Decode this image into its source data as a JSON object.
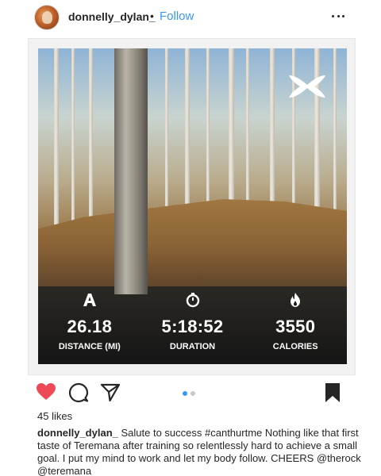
{
  "header": {
    "username": "donnelly_dylan_",
    "separator": "•",
    "follow_label": "Follow"
  },
  "media": {
    "brand_logo": "under-armour-logo",
    "stats": [
      {
        "icon": "map-a-icon",
        "value": "26.18",
        "label": "DISTANCE (MI)"
      },
      {
        "icon": "stopwatch-icon",
        "value": "5:18:52",
        "label": "DURATION"
      },
      {
        "icon": "flame-icon",
        "value": "3550",
        "label": "CALORIES"
      }
    ]
  },
  "actions": {
    "like_color": "#ed4956",
    "carousel_pages": 2,
    "carousel_active": 1
  },
  "likes": "45 likes",
  "caption": {
    "username": "donnelly_dylan_",
    "text": "Salute to success #canthurtme Nothing like that first taste of Teremana after training so relentlessly hard to achieve a small goal. I put my mind to work and let my body follow. CHEERS @therock @teremana"
  },
  "colors": {
    "link": "#3897f0",
    "text": "#262626"
  }
}
